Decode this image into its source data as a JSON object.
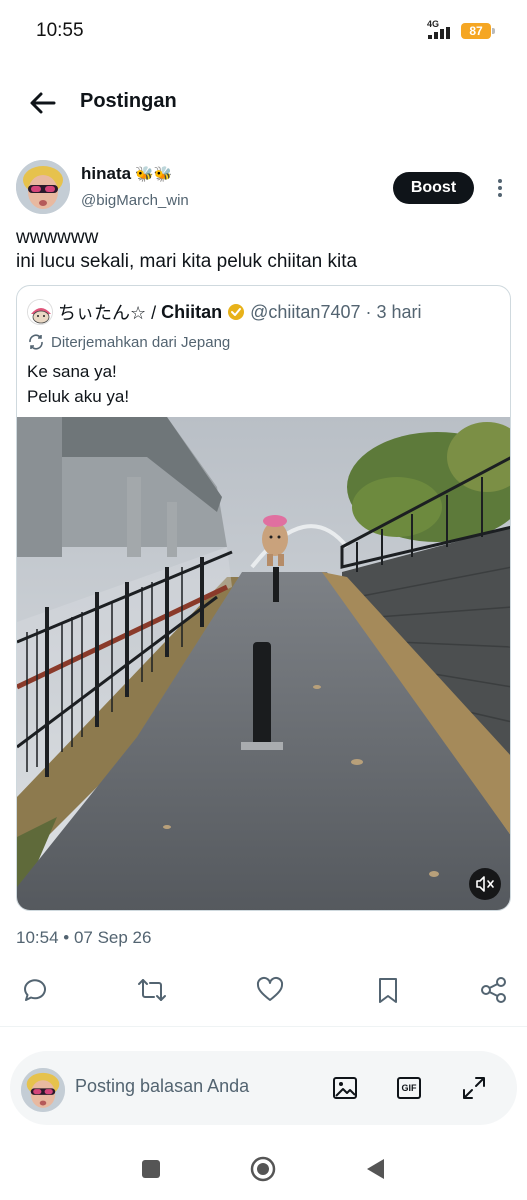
{
  "status_bar": {
    "time": "10:55",
    "network": "4G",
    "battery": "87"
  },
  "header": {
    "title": "Postingan",
    "back_icon": "arrow-left-icon"
  },
  "post": {
    "author_name": "hinata",
    "author_emoji": "🐝🐝",
    "author_handle": "@bigMarch_win",
    "boost_label": "Boost",
    "text_lines": [
      "wwwwww",
      "ini lucu sekali, mari kita peluk chiitan kita"
    ],
    "timestamp": "10:54 • 07 Sep 26"
  },
  "quote": {
    "name_jp": "ちぃたん☆ / ",
    "name": "Chiitan",
    "handle_time": "@chiitan7407 · 3 hari",
    "translated_label": "Diterjemahkan dari Jepang",
    "text_lines": [
      "Ke sana ya!",
      "Peluk aku ya!"
    ]
  },
  "actions": [
    "reply-icon",
    "repost-icon",
    "like-icon",
    "bookmark-icon",
    "share-icon"
  ],
  "reply_bar": {
    "placeholder": "Posting balasan Anda",
    "gif_label": "GIF"
  },
  "colors": {
    "accent": "#1d9bf0",
    "verified_gold": "#e8b21a",
    "battery": "#f5a623",
    "text": "#0f1419",
    "secondary": "#536471"
  }
}
